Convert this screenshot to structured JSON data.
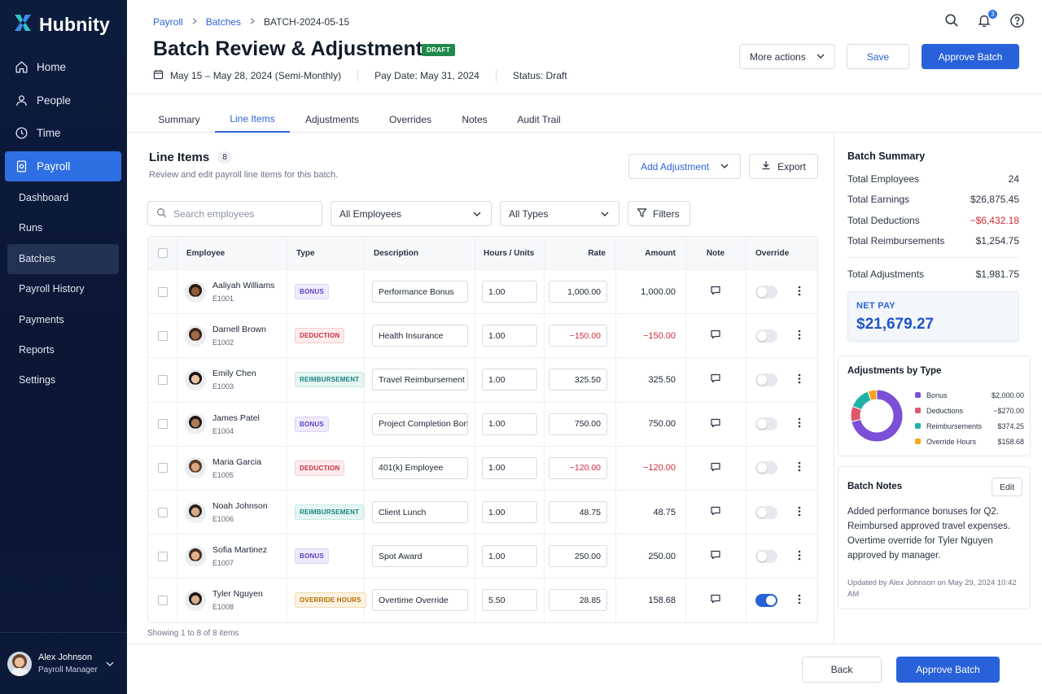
{
  "app": {
    "brand": "Hubnity"
  },
  "sidebar": {
    "main": [
      {
        "label": "Home",
        "icon": "home-icon"
      },
      {
        "label": "People",
        "icon": "user-icon"
      },
      {
        "label": "Time",
        "icon": "clock-icon"
      },
      {
        "label": "Payroll",
        "icon": "payroll-icon",
        "active": true
      }
    ],
    "sub": [
      {
        "label": "Dashboard"
      },
      {
        "label": "Runs"
      },
      {
        "label": "Batches",
        "active": true
      },
      {
        "label": "Payroll History"
      },
      {
        "label": "Payments"
      },
      {
        "label": "Reports"
      },
      {
        "label": "Settings"
      }
    ],
    "user": {
      "name": "Alex Johnson",
      "role": "Payroll Manager"
    }
  },
  "header": {
    "breadcrumb": [
      "Payroll",
      "Batches",
      "BATCH-2024-05-15"
    ],
    "title": "Batch Review & Adjustments",
    "badge": "DRAFT",
    "period": "May 15 – May 28, 2024 (Semi-Monthly)",
    "pay_date": "Pay Date: May 31, 2024",
    "status": "Status: Draft",
    "notification_count": "3",
    "more_actions": "More actions",
    "save": "Save",
    "approve": "Approve Batch"
  },
  "tabs": [
    {
      "label": "Summary"
    },
    {
      "label": "Line Items",
      "active": true
    },
    {
      "label": "Adjustments"
    },
    {
      "label": "Overrides"
    },
    {
      "label": "Notes"
    },
    {
      "label": "Audit Trail"
    }
  ],
  "line_items": {
    "title": "Line Items",
    "count": "8",
    "subtitle": "Review and edit payroll line items for this batch.",
    "add_adjustment": "Add Adjustment",
    "export": "Export",
    "search_placeholder": "Search employees",
    "employee_filter": "All Employees",
    "type_filter": "All Types",
    "filters": "Filters",
    "columns": [
      "Employee",
      "Type",
      "Description",
      "Hours / Units",
      "Rate",
      "Amount",
      "Note",
      "Override"
    ],
    "rows": [
      {
        "name": "Aaliyah Williams",
        "id": "E1001",
        "type": "BONUS",
        "type_class": "t-bonus",
        "description": "Performance Bonus",
        "hours": "1.00",
        "rate": "1,000.00",
        "amount": "1,000.00",
        "negative": false,
        "override": false,
        "avatar_skin": "#8d5a3b",
        "avatar_hair": "#2b1a12"
      },
      {
        "name": "Darnell Brown",
        "id": "E1002",
        "type": "DEDUCTION",
        "type_class": "t-deduction",
        "description": "Health Insurance",
        "hours": "1.00",
        "rate": "−150.00",
        "amount": "−150.00",
        "negative": true,
        "override": false,
        "avatar_skin": "#a06b48",
        "avatar_hair": "#3b2617"
      },
      {
        "name": "Emily Chen",
        "id": "E1003",
        "type": "REIMBURSEMENT",
        "type_class": "t-reimb",
        "description": "Travel Reimbursement",
        "hours": "1.00",
        "rate": "325.50",
        "amount": "325.50",
        "negative": false,
        "override": false,
        "avatar_skin": "#e5c0a0",
        "avatar_hair": "#1c1412"
      },
      {
        "name": "James Patel",
        "id": "E1004",
        "type": "BONUS",
        "type_class": "t-bonus",
        "description": "Project Completion Bonus",
        "hours": "1.00",
        "rate": "750.00",
        "amount": "750.00",
        "negative": false,
        "override": false,
        "avatar_skin": "#b07a55",
        "avatar_hair": "#1d1713"
      },
      {
        "name": "Maria Garcia",
        "id": "E1005",
        "type": "DEDUCTION",
        "type_class": "t-deduction",
        "description": "401(k) Employee",
        "hours": "1.00",
        "rate": "−120.00",
        "amount": "−120.00",
        "negative": true,
        "override": false,
        "avatar_skin": "#d7a581",
        "avatar_hair": "#5a3a24"
      },
      {
        "name": "Noah Johnson",
        "id": "E1006",
        "type": "REIMBURSEMENT",
        "type_class": "t-reimb",
        "description": "Client Lunch",
        "hours": "1.00",
        "rate": "48.75",
        "amount": "48.75",
        "negative": false,
        "override": false,
        "avatar_skin": "#d6a887",
        "avatar_hair": "#2a1f19"
      },
      {
        "name": "Sofia Martinez",
        "id": "E1007",
        "type": "BONUS",
        "type_class": "t-bonus",
        "description": "Spot Award",
        "hours": "1.00",
        "rate": "250.00",
        "amount": "250.00",
        "negative": false,
        "override": false,
        "avatar_skin": "#deb08c",
        "avatar_hair": "#4a2e1c"
      },
      {
        "name": "Tyler Nguyen",
        "id": "E1008",
        "type": "OVERRIDE HOURS",
        "type_class": "t-override",
        "description": "Overtime Override",
        "hours": "5.50",
        "rate": "28.85",
        "amount": "158.68",
        "negative": false,
        "override": true,
        "avatar_skin": "#d9ad8b",
        "avatar_hair": "#1b1613"
      }
    ],
    "showing": "Showing 1 to 8 of 8 items"
  },
  "summary": {
    "title": "Batch Summary",
    "rows": [
      {
        "label": "Total Employees",
        "value": "24",
        "negative": false
      },
      {
        "label": "Total Earnings",
        "value": "$26,875.45",
        "negative": false
      },
      {
        "label": "Total Deductions",
        "value": "−$6,432.18",
        "negative": true
      },
      {
        "label": "Total Reimbursements",
        "value": "$1,254.75",
        "negative": false
      }
    ],
    "adjustments_label": "Total Adjustments",
    "adjustments_value": "$1,981.75",
    "net_label": "NET PAY",
    "net_value": "$21,679.27"
  },
  "adjustments_chart": {
    "title": "Adjustments by Type",
    "colors": [
      "#7b4fd6",
      "#e0566a",
      "#1fb2a6",
      "#f5a623"
    ],
    "chart_data": {
      "type": "pie",
      "categories": [
        "Bonus",
        "Deductions",
        "Reimbursements",
        "Override Hours"
      ],
      "values": [
        2000.0,
        -270.0,
        374.25,
        158.68
      ],
      "labels": [
        "$2,000.00",
        "−$270.00",
        "$374.25",
        "$158.68"
      ]
    }
  },
  "notes": {
    "title": "Batch Notes",
    "edit": "Edit",
    "text": "Added performance bonuses for Q2. Reimbursed approved travel expenses. Overtime override for Tyler Nguyen approved by manager.",
    "meta": "Updated by Alex Johnson on May 29, 2024 10:42 AM"
  },
  "footer": {
    "back": "Back",
    "approve": "Approve Batch"
  }
}
